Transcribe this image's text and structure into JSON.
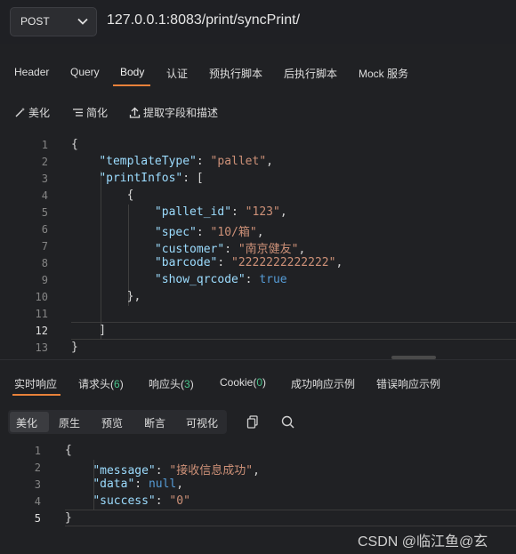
{
  "request": {
    "method": "POST",
    "url": "127.0.0.1:8083/print/syncPrint/"
  },
  "request_tabs": [
    {
      "label": "Header"
    },
    {
      "label": "Query"
    },
    {
      "label": "Body"
    },
    {
      "label": "认证"
    },
    {
      "label": "预执行脚本"
    },
    {
      "label": "后执行脚本"
    },
    {
      "label": "Mock 服务"
    }
  ],
  "active_request_tab": "Body",
  "toolbar": {
    "beautify": "美化",
    "simplify": "简化",
    "extract": "提取字段和描述"
  },
  "body_editor": {
    "line_numbers": [
      "1",
      "2",
      "3",
      "4",
      "5",
      "6",
      "7",
      "8",
      "9",
      "10",
      "11",
      "12",
      "13"
    ],
    "current_line": "12",
    "lines": [
      "{",
      "    \"templateType\": \"pallet\",",
      "    \"printInfos\": [",
      "        {",
      "            \"pallet_id\": \"123\",",
      "            \"spec\": \"10/箱\",",
      "            \"customer\": \"南京健友\",",
      "            \"barcode\": \"2222222222222\",",
      "            \"show_qrcode\": true",
      "        },",
      "",
      "    ]",
      "}"
    ]
  },
  "response_tabs": [
    {
      "label": "实时响应",
      "count": ""
    },
    {
      "label": "请求头",
      "count": "6"
    },
    {
      "label": "响应头",
      "count": "3"
    },
    {
      "label": "Cookie",
      "count": "0"
    },
    {
      "label": "成功响应示例",
      "count": ""
    },
    {
      "label": "错误响应示例",
      "count": ""
    }
  ],
  "response_view_tabs": [
    "美化",
    "原生",
    "预览",
    "断言",
    "可视化"
  ],
  "response_icons": [
    "copy-icon",
    "search-icon"
  ],
  "response_editor": {
    "line_numbers": [
      "1",
      "2",
      "3",
      "4",
      "5"
    ],
    "current_line": "5",
    "lines": [
      "{",
      "    \"message\": \"接收信息成功\",",
      "    \"data\": null,",
      "    \"success\": \"0\"",
      "}"
    ]
  },
  "watermark": "CSDN @临江鱼@玄",
  "colors": {
    "accent": "#e8813a",
    "count_green": "#49c28a",
    "json_key": "#9cdcfe",
    "json_string": "#ce9178",
    "json_keyword": "#569cd6"
  }
}
